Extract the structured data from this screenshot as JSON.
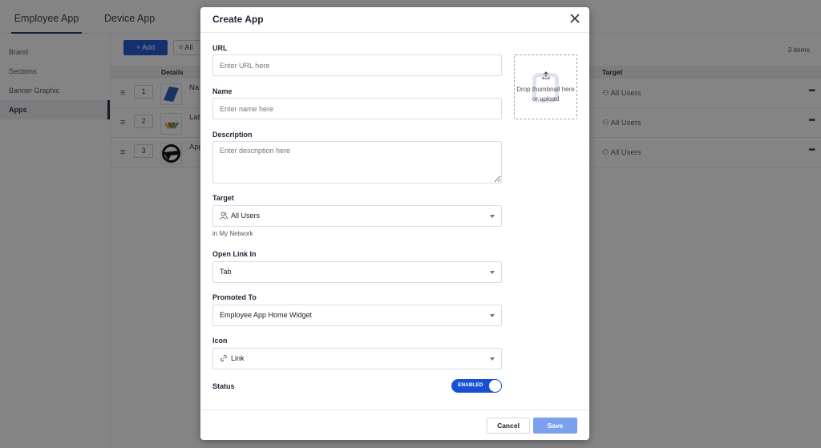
{
  "tabs": [
    {
      "label": "Employee App",
      "active": true
    },
    {
      "label": "Device App",
      "active": false
    }
  ],
  "sidebar": {
    "items": [
      {
        "label": "Brand",
        "active": false
      },
      {
        "label": "Sections",
        "active": false
      },
      {
        "label": "Banner Graphic",
        "active": false
      },
      {
        "label": "Apps",
        "active": true
      }
    ]
  },
  "toolbar": {
    "add_label": "+ Add",
    "filter_label": "All",
    "count": "3 items"
  },
  "table": {
    "headers": {
      "details": "Details",
      "target": "Target"
    },
    "rows": [
      {
        "order": "1",
        "name": "Na",
        "target": "All Users"
      },
      {
        "order": "2",
        "name": "Lat",
        "target": "All Users"
      },
      {
        "order": "3",
        "name": "App",
        "target": "All Users"
      }
    ],
    "more_label": "•••"
  },
  "modal": {
    "title": "Create App",
    "url": {
      "label": "URL",
      "placeholder": "Enter URL here",
      "value": ""
    },
    "name": {
      "label": "Name",
      "placeholder": "Enter name here",
      "value": ""
    },
    "description": {
      "label": "Description",
      "placeholder": "Enter description here",
      "value": ""
    },
    "thumbnail": {
      "text": "Drop thumbnail here or upload"
    },
    "target": {
      "label": "Target",
      "value": "All Users",
      "helper": "in My Network"
    },
    "open_link_in": {
      "label": "Open Link In",
      "value": "Tab"
    },
    "promoted_to": {
      "label": "Promoted To",
      "value": "Employee App Home Widget"
    },
    "icon": {
      "label": "Icon",
      "value": "Link"
    },
    "status": {
      "label": "Status",
      "toggle_label": "ENABLED",
      "enabled": true
    },
    "cancel_label": "Cancel",
    "save_label": "Save"
  },
  "colors": {
    "primary": "#1750d6",
    "save_disabled": "#7aa0ee",
    "tab_underline": "#1a2c60"
  }
}
